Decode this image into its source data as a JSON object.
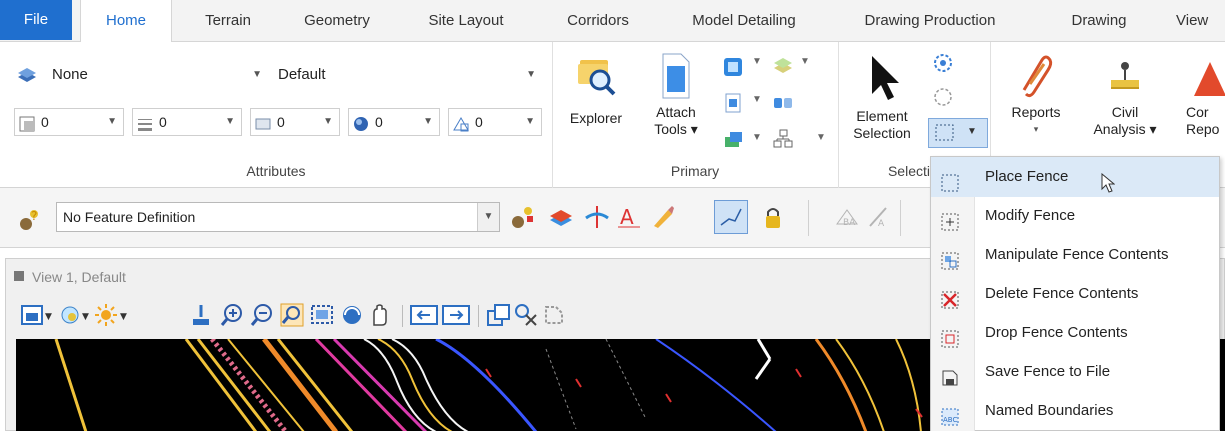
{
  "tabs": [
    {
      "label": "File"
    },
    {
      "label": "Home"
    },
    {
      "label": "Terrain"
    },
    {
      "label": "Geometry"
    },
    {
      "label": "Site Layout"
    },
    {
      "label": "Corridors"
    },
    {
      "label": "Model Detailing"
    },
    {
      "label": "Drawing Production"
    },
    {
      "label": "Drawing"
    },
    {
      "label": "View"
    }
  ],
  "attributes": {
    "level": "None",
    "style_set": "Default",
    "small": [
      "0",
      "0",
      "0",
      "0",
      "0"
    ],
    "group_label": "Attributes"
  },
  "primary": {
    "explorer": "Explorer",
    "attach_line1": "Attach",
    "attach_line2": "Tools ▾",
    "group_label": "Primary"
  },
  "selection": {
    "element_line1": "Element",
    "element_line2": "Selection",
    "group_label": "Selecti"
  },
  "reports": {
    "reports": "Reports",
    "reports_arrow": "▾",
    "civil_line1": "Civil",
    "civil_line2": "Analysis ▾",
    "corr_line1": "Cor",
    "corr_line2": "Repo"
  },
  "feature": {
    "definition": "No Feature Definition"
  },
  "view": {
    "title": "View 1, Default"
  },
  "fence_menu": [
    {
      "label": "Place Fence",
      "icon": "place-fence-icon"
    },
    {
      "label": "Modify Fence",
      "icon": "modify-fence-icon"
    },
    {
      "label": "Manipulate Fence Contents",
      "icon": "manipulate-fence-icon"
    },
    {
      "label": "Delete Fence Contents",
      "icon": "delete-fence-icon"
    },
    {
      "label": "Drop Fence Contents",
      "icon": "drop-fence-icon"
    },
    {
      "label": "Save Fence to File",
      "icon": "save-fence-icon"
    },
    {
      "label": "Named Boundaries",
      "icon": "named-boundaries-icon"
    }
  ],
  "colors": {
    "accent": "#1f6fcf",
    "menu_hover": "#dbe9f7"
  }
}
